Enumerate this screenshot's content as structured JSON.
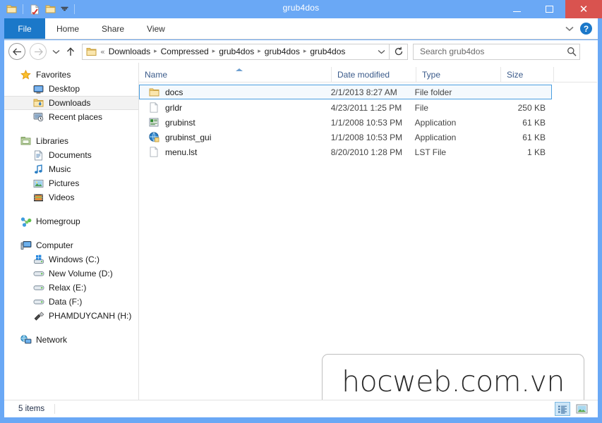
{
  "window": {
    "title": "grub4dos",
    "colors": {
      "titlebar": "#6aa8f5",
      "file_tab": "#1b78c9",
      "close_button": "#d9534f",
      "selection_border": "#4a9ee0"
    },
    "controls": {
      "minimize": "minimize",
      "maximize": "maximize",
      "close": "✕"
    }
  },
  "quick_access": {
    "items": [
      {
        "name": "window-menu-icon",
        "glyph": "folder"
      },
      {
        "name": "properties-icon",
        "glyph": "doc-check"
      },
      {
        "name": "new-folder-icon",
        "glyph": "folder"
      },
      {
        "name": "customize-qat-dropdown",
        "glyph": "▾"
      }
    ]
  },
  "ribbon": {
    "file_tab": "File",
    "tabs": [
      "Home",
      "Share",
      "View"
    ],
    "expand_label": "⌄",
    "help_label": "?"
  },
  "address_bar": {
    "back": "←",
    "forward": "→",
    "recent_dropdown": "▾",
    "up": "↑",
    "breadcrumb_prefix": "«",
    "breadcrumbs": [
      "Downloads",
      "Compressed",
      "grub4dos",
      "grub4dos",
      "grub4dos"
    ],
    "breadcrumb_separator": "▸",
    "breadcrumb_dropdown": "⌄",
    "refresh": "↻",
    "search_placeholder": "Search grub4dos",
    "search_value": ""
  },
  "sidebar": {
    "groups": [
      {
        "header": {
          "label": "Favorites",
          "icon": "star-icon"
        },
        "items": [
          {
            "label": "Desktop",
            "icon": "desktop-icon",
            "selected": false
          },
          {
            "label": "Downloads",
            "icon": "downloads-folder-icon",
            "selected": true
          },
          {
            "label": "Recent places",
            "icon": "recent-places-icon",
            "selected": false
          }
        ]
      },
      {
        "header": {
          "label": "Libraries",
          "icon": "libraries-icon"
        },
        "items": [
          {
            "label": "Documents",
            "icon": "documents-icon",
            "selected": false
          },
          {
            "label": "Music",
            "icon": "music-note-icon",
            "selected": false
          },
          {
            "label": "Pictures",
            "icon": "pictures-icon",
            "selected": false
          },
          {
            "label": "Videos",
            "icon": "videos-icon",
            "selected": false
          }
        ]
      },
      {
        "header": {
          "label": "Homegroup",
          "icon": "homegroup-icon"
        },
        "items": []
      },
      {
        "header": {
          "label": "Computer",
          "icon": "computer-icon"
        },
        "items": [
          {
            "label": "Windows (C:)",
            "icon": "windows-drive-icon",
            "selected": false
          },
          {
            "label": "New Volume (D:)",
            "icon": "drive-icon",
            "selected": false
          },
          {
            "label": "Relax (E:)",
            "icon": "drive-icon",
            "selected": false
          },
          {
            "label": "Data (F:)",
            "icon": "drive-icon",
            "selected": false
          },
          {
            "label": "PHAMDUYCANH (H:)",
            "icon": "usb-drive-icon",
            "selected": false
          }
        ]
      },
      {
        "header": {
          "label": "Network",
          "icon": "network-icon"
        },
        "items": []
      }
    ]
  },
  "file_list": {
    "columns": [
      "Name",
      "Date modified",
      "Type",
      "Size"
    ],
    "sorted_by": "Name",
    "sort_direction": "ascending",
    "rows": [
      {
        "name": "docs",
        "date_modified": "2/1/2013 8:27 AM",
        "type": "File folder",
        "size": "",
        "icon": "folder-icon",
        "selected": true
      },
      {
        "name": "grldr",
        "date_modified": "4/23/2011 1:25 PM",
        "type": "File",
        "size": "250 KB",
        "icon": "generic-file-icon",
        "selected": false
      },
      {
        "name": "grubinst",
        "date_modified": "1/1/2008 10:53 PM",
        "type": "Application",
        "size": "61 KB",
        "icon": "console-application-icon",
        "selected": false
      },
      {
        "name": "grubinst_gui",
        "date_modified": "1/1/2008 10:53 PM",
        "type": "Application",
        "size": "61 KB",
        "icon": "gui-application-icon",
        "selected": false
      },
      {
        "name": "menu.lst",
        "date_modified": "8/20/2010 1:28 PM",
        "type": "LST File",
        "size": "1 KB",
        "icon": "generic-file-icon",
        "selected": false
      }
    ]
  },
  "status_bar": {
    "item_count": "5 items",
    "views": [
      {
        "name": "details-view-button",
        "active": true
      },
      {
        "name": "large-icons-view-button",
        "active": false
      }
    ]
  },
  "watermark": {
    "text": "hocweb.com.vn"
  }
}
